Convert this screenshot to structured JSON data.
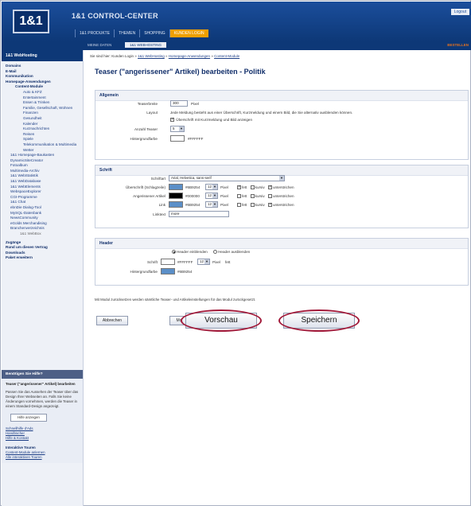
{
  "header": {
    "logo": "1&1",
    "title": "1&1 CONTROL-CENTER",
    "logout": "Logout",
    "nav": [
      "1&1 PRODUKTE",
      "THEMEN",
      "SHOPPING",
      "KUNDEN LOGIN"
    ],
    "subnav": [
      "MEINE DATEN",
      "1&1 WEBHOSTING"
    ],
    "bestellen": "BESTELLEN"
  },
  "sidebar": {
    "head": "1&1 WebHosting",
    "items": [
      "Domains",
      "E-Mail",
      "Kommunikation",
      "Homepage-Anwendungen",
      "Content-Module",
      "Auto & KFZ",
      "Entertainment",
      "Essen & Trinken",
      "Familie, Gesellschaft, Wohnen",
      "Finanzen",
      "Gesundheit",
      "Kalender",
      "Kurznachrichten",
      "Reisen",
      "Spiele",
      "Telekommunikation & Multimedia",
      "Wetter",
      "1&1 Homepage-Baukasten",
      "DynamicSiteCreator",
      "Fotoalbum",
      "Multimedia-Archiv",
      "1&1 WebStatistik",
      "1&1 WebDatabase",
      "1&1 WebElements",
      "WebspaceExplorer",
      "CGI-Programme",
      "1&1 Chat",
      "ebnDie Dialog-Tool",
      "MySQL-Datenbank",
      "NewsCommunity",
      "eGolds Merchandising",
      "Branchenverzeichnis",
      "1&1 WebBox",
      "Zugänge",
      "Rund um diesen Vertrag",
      "Downloads",
      "Paket erweitern"
    ],
    "box_head": "Benötigen Sie Hilfe?",
    "box_title": "Teaser (\"angerissener\" Artikel) bearbeiten",
    "box_text": "Passen Sie das Aussehen der Teaser über das Design Ihrer Webseiten an. Falls Sie keine Änderungen vornehmen, werden die Teaser in einem Standard-Design angezeigt.",
    "box_btn": "Hilfe anzeigen",
    "links_a": [
      "Schnellhilfe d'Ads",
      "Handbücher",
      "Hilfe & Kontakt"
    ],
    "tours_head": "Interaktive Touren",
    "links_b": [
      "Content-Module anlernen",
      "Alle interaktiven Touren"
    ]
  },
  "main": {
    "breadcrumb": [
      "Sie sind hier: Kunden Login",
      "1&1 WebHosting",
      "Homepage-Anwendungen",
      "Content-Module"
    ],
    "title": "Teaser (\"angerissener\" Artikel) bearbeiten - Politik",
    "allgemein": {
      "head": "Allgemein",
      "teaserbreite_label": "Teaserbreite",
      "teaserbreite_value": "300",
      "teaserbreite_unit": "Pixel",
      "layout_label": "Layout",
      "layout_text": "Jede Meldung besteht aus einer Überschrift, Kurzmeldung und einem Bild, die Sie alternativ ausblenden können.",
      "layout_check": "Überschrift mit Kurzmeldung und Bild anzeigen",
      "anzahl_label": "Anzahl Teaser",
      "anzahl_value": "5",
      "hg_label": "Hintergrundfarbe",
      "hg_value": "#FFFFFF",
      "hg_color": "#ffffff"
    },
    "schrift": {
      "head": "Schrift",
      "schriftart_label": "Schriftart",
      "schriftart_value": "Arial, Helvetica, sans-serif",
      "rows": [
        {
          "label": "Überschrift (Schlagzeile)",
          "hex": "#6B9254",
          "color": "#5b8fc8",
          "size": "12",
          "fett": true,
          "kursiv": false,
          "unterstr": true
        },
        {
          "label": "Angerissener Artikel",
          "hex": "#000000",
          "color": "#000000",
          "size": "12",
          "fett": false,
          "kursiv": false,
          "unterstr": false
        },
        {
          "label": "Link",
          "hex": "#6B9254",
          "color": "#5b8fc8",
          "size": "12",
          "fett": false,
          "kursiv": false,
          "unterstr": true
        }
      ],
      "pixel": "Pixel",
      "fett": "fett",
      "kursiv": "kursiv",
      "unterstr": "unterstrichen",
      "linktext_label": "Linktext",
      "linktext_value": "more"
    },
    "header_sec": {
      "head": "Header",
      "radio1": "Header einblenden",
      "radio2": "Header ausblenden",
      "schrift_label": "Schrift",
      "schrift_hex": "#FFFFFF",
      "schrift_color": "#ffffff",
      "schrift_size": "12",
      "fett": "fett",
      "hg_label": "Hintergrundfarbe",
      "hg_hex": "#6B9254",
      "hg_color": "#5b8fc8"
    },
    "note": "Mit Modul zurücksetzen werden sämtliche Teaser- und Artikeleinstellungen für das Modul zurückgesetzt.",
    "buttons": {
      "abbrechen": "Abbrechen",
      "modul": "Mo",
      "vorschau": "Vorschau",
      "speichern": "Speichern"
    },
    "highlight_color": "#a21a3a"
  }
}
